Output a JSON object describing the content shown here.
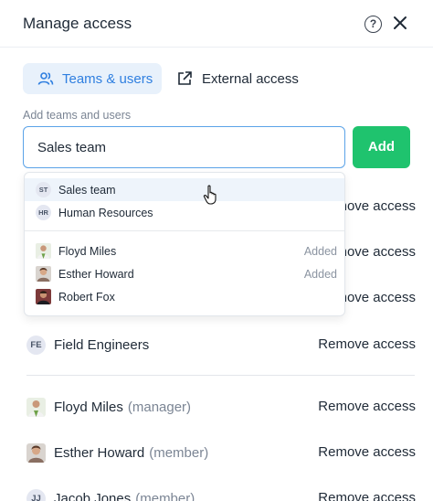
{
  "header": {
    "title": "Manage access",
    "help_icon": "help-circle-icon",
    "close_icon": "close-icon"
  },
  "tabs": [
    {
      "label": "Teams & users",
      "icon": "users-icon",
      "active": true
    },
    {
      "label": "External access",
      "icon": "external-link-icon",
      "active": false
    }
  ],
  "form": {
    "label": "Add teams and users",
    "input_value": "Sales team",
    "add_label": "Add"
  },
  "dropdown": {
    "teams": [
      {
        "initials": "ST",
        "name": "Sales team",
        "highlighted": true
      },
      {
        "initials": "HR",
        "name": "Human Resources",
        "highlighted": false
      }
    ],
    "users": [
      {
        "name": "Floyd Miles",
        "status": "Added"
      },
      {
        "name": "Esther Howard",
        "status": "Added"
      },
      {
        "name": "Robert Fox",
        "status": ""
      }
    ]
  },
  "access_list": {
    "remove_label": "Remove access",
    "teams": [
      {
        "initials": "",
        "name": ""
      },
      {
        "initials": "",
        "name": ""
      },
      {
        "initials": "",
        "name": ""
      },
      {
        "initials": "FE",
        "name": "Field Engineers"
      }
    ],
    "users": [
      {
        "name": "Floyd Miles",
        "role": "(manager)"
      },
      {
        "name": "Esther Howard",
        "role": "(member)"
      },
      {
        "initials": "JJ",
        "name": "Jacob Jones",
        "role": "(member)"
      }
    ]
  },
  "colors": {
    "accent": "#2f7fe0",
    "accent_bg": "#e8f1fb",
    "add_button": "#1fc36e",
    "input_border": "#5ba3e8"
  }
}
